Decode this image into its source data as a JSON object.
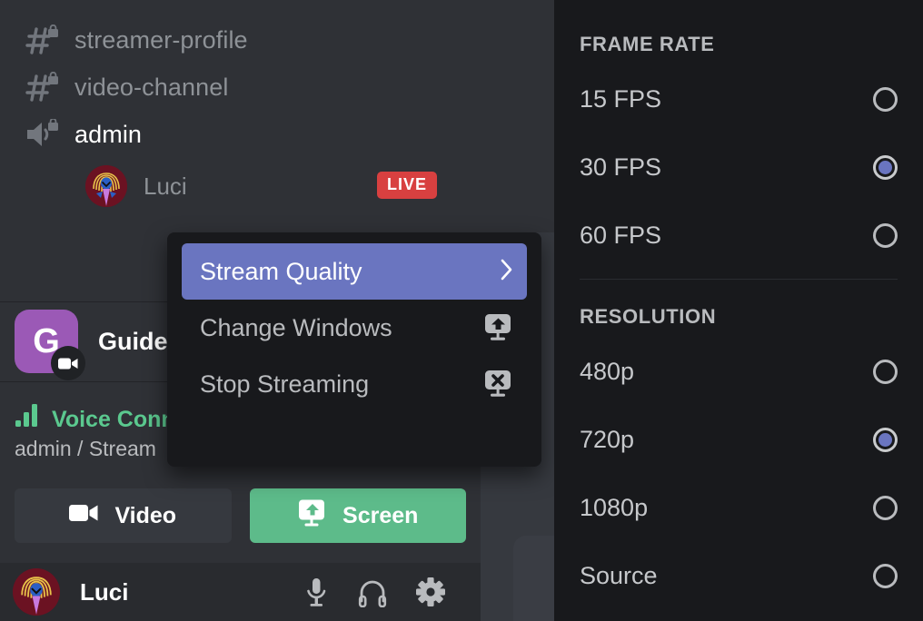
{
  "sidebar": {
    "channels": [
      {
        "name": "streamer-profile",
        "icon": "hash-lock-icon",
        "active": false
      },
      {
        "name": "video-channel",
        "icon": "hash-lock-icon",
        "active": false
      },
      {
        "name": "admin",
        "icon": "speaker-lock-icon",
        "active": true
      }
    ],
    "streaming_user": {
      "name": "Luci",
      "badge": "LIVE"
    },
    "guild": {
      "initial": "G",
      "name": "Guides",
      "badge_icon": "video-camera-icon"
    },
    "voice": {
      "status": "Voice Connected",
      "detail": "admin / Stream",
      "status_icon": "signal-bars-icon",
      "status_color": "#5bc98f"
    },
    "buttons": [
      {
        "label": "Video",
        "icon": "video-camera-icon",
        "style": "neutral"
      },
      {
        "label": "Screen",
        "icon": "screen-share-icon",
        "style": "green",
        "color": "#5dbb8a"
      }
    ],
    "user_bar": {
      "username": "Luci",
      "controls": [
        {
          "icon": "microphone-icon"
        },
        {
          "icon": "headphones-icon"
        },
        {
          "icon": "gear-icon"
        }
      ]
    }
  },
  "context_menu": {
    "items": [
      {
        "label": "Stream Quality",
        "selected": true,
        "trailing": "chevron-right-icon"
      },
      {
        "label": "Change Windows",
        "selected": false,
        "trailing": "screen-share-icon"
      },
      {
        "label": "Stop Streaming",
        "selected": false,
        "trailing": "screen-stop-icon"
      }
    ],
    "highlight_color": "#6a75c0"
  },
  "submenu": {
    "sections": [
      {
        "heading": "FRAME RATE",
        "options": [
          {
            "label": "15 FPS",
            "selected": false
          },
          {
            "label": "30 FPS",
            "selected": true
          },
          {
            "label": "60 FPS",
            "selected": false
          }
        ]
      },
      {
        "heading": "RESOLUTION",
        "options": [
          {
            "label": "480p",
            "selected": false
          },
          {
            "label": "720p",
            "selected": true
          },
          {
            "label": "1080p",
            "selected": false
          },
          {
            "label": "Source",
            "selected": false
          }
        ]
      }
    ],
    "radio_accent": "#6a75c0"
  }
}
